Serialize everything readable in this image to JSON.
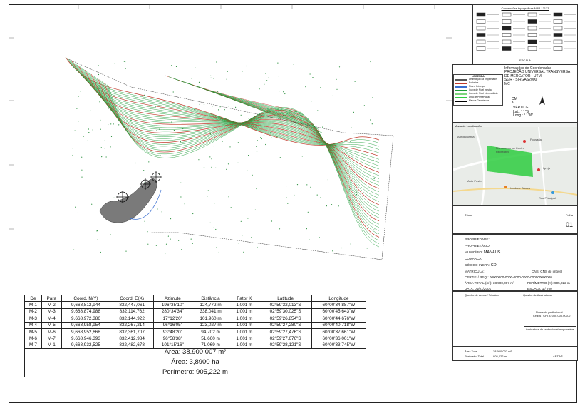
{
  "legend_box": {
    "title": "Convenções topográficas NBR 13133",
    "scale_label": "ESCALA"
  },
  "coordinates_info": {
    "heading": "Informações de Coordenadas",
    "projection": "PROJEÇÃO UNIVERSAL TRANSVERSA",
    "projection2": "DE MERCATOR - UTM",
    "datum": "SGR - SIRGAS2000",
    "mc": "MC",
    "cm_label": "CM",
    "k_label": "K",
    "vertice_label": "VÉRTICE:",
    "lat_label": "Lat.:",
    "lat_suffix": "S",
    "long_label": "Long.:",
    "long_suffix": "W"
  },
  "map_legend": {
    "title": "LEGENDA",
    "items": [
      "Delimitação da propriedade",
      "Rodovias",
      "Rios e Córregos",
      "Curva de Nível mestra",
      "Curva de Nível intermediária",
      "Área de Preservação",
      "Marcos Geodésicos"
    ]
  },
  "location_map": {
    "title": "Mapa de Localização",
    "labels": [
      "Agroindústria",
      "Pousada",
      "Monumento ao Centro Recreativo",
      "Igreja",
      "Auto Posto",
      "Unidade Básica",
      "Rua Principal"
    ]
  },
  "title_block": {
    "title_label": "Título",
    "sheet_label": "Folha",
    "sheet_value": "01",
    "proprietario_label": "PROPRIEDADE:",
    "proprietario2_label": "PROPRIETÁRIO:",
    "municipio_label": "MUNICÍPIO:",
    "municipio_value": "MANAUS",
    "comarca_label": "COMARCA:",
    "cod_incra_label": "CÓDIGO INCRA:",
    "cod_incra_value": "CD",
    "matricula_label": "MATRÍCULA:",
    "cns_label": "CNS:",
    "cns_value": "CNS do imóvel",
    "certificacao_label": "CERTIF. / REQ.:",
    "certificacao_value": "00000000-0000-0000-0000-000000000000",
    "area_label": "ÁREA TOTAL (m²):",
    "area_value": "38.900,007 m²",
    "perimetro_label": "PERÍMETRO (m):",
    "perimetro_value": "905,222 m",
    "data_label": "DATA:",
    "data_value": "01/01/2001",
    "escala_label": "ESCALA:",
    "escala_value": "1 / 700",
    "resp_tecnico": "Quadro de Áreas / Técnico",
    "resp_assinatura": "Quadro de Assinaturas",
    "assin_nome": "Nome do profissional",
    "assin_crea": "CREA / CFTA: 000.000.000-0",
    "assin_linha": "Assinatura do profissional responsável",
    "area_total_label": "Área Total",
    "area_total_value": "38.900,007 m²",
    "perimetro_total_label": "Perímetro Total",
    "perimetro_total_value": "905,222 m",
    "art_label": "ART Nº"
  },
  "table": {
    "headers": [
      "De",
      "Para",
      "Coord. N(Y)",
      "Coord. E(X)",
      "Azimute",
      "Distância",
      "Fator K",
      "Latitude",
      "Longitude"
    ],
    "rows": [
      [
        "M-1",
        "M-2",
        "9,668,812,944",
        "832,447,061",
        "196°35'10\"",
        "124,772 m",
        "1,001 m",
        "02°59'32,013\"S",
        "60°00'34,887\"W"
      ],
      [
        "M-2",
        "M-3",
        "9,668,874,988",
        "832,114,762",
        "280°34'34\"",
        "338,041 m",
        "1,001 m",
        "02°59'30,025\"S",
        "60°00'45,643\"W"
      ],
      [
        "M-3",
        "M-4",
        "9,668,972,386",
        "832,144,922",
        "17°12'20\"",
        "101,960 m",
        "1,001 m",
        "02°59'26,854\"S",
        "60°00'44,676\"W"
      ],
      [
        "M-4",
        "M-5",
        "9,668,958,954",
        "832,267,214",
        "96°16'05\"",
        "123,027 m",
        "1,001 m",
        "02°59'27,280\"S",
        "60°00'40,718\"W"
      ],
      [
        "M-5",
        "M-6",
        "9,668,952,668",
        "832,361,707",
        "93°48'20\"",
        "94,702 m",
        "1,001 m",
        "02°59'27,476\"S",
        "60°00'37,661\"W"
      ],
      [
        "M-6",
        "M-7",
        "9,668,946,393",
        "832,412,984",
        "96°58'38\"",
        "51,660 m",
        "1,001 m",
        "02°59'27,676\"S",
        "60°00'36,001\"W"
      ],
      [
        "M-7",
        "M-1",
        "9,668,932,525",
        "832,482,678",
        "101°15'16\"",
        "71,069 m",
        "1,001 m",
        "02°59'28,121\"S",
        "60°00'33,745\"W"
      ]
    ],
    "total_area_m2": "Área: 38.900,007 m²",
    "total_area_ha": "Área: 3,8900 ha",
    "total_perimetro": "Perímetro: 905,222 m"
  },
  "colors": {
    "contour_green": "#1f9d3a",
    "contour_red": "#c0392b",
    "lake": "#7a7a7a",
    "boundary_blue": "#3a6fd1",
    "location_polygon": "#2ecc40"
  }
}
